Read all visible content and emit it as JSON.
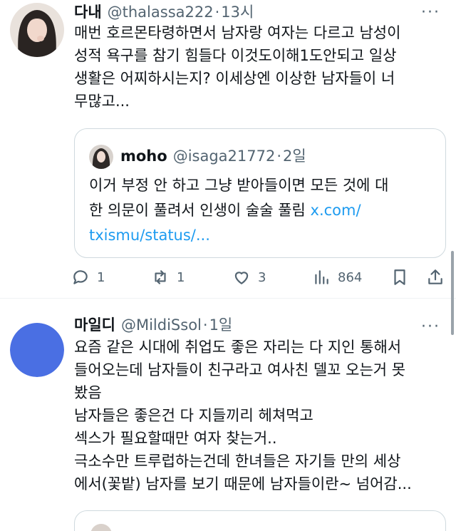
{
  "tweet1": {
    "name": "다내",
    "handle": "@thalassa222",
    "separator": "·",
    "time": "13시",
    "more": "···",
    "lines": [
      "매번 호르몬타령하면서 남자랑 여자는 다르고 남성이",
      "성적 욕구를 참기 힘들다 이것도이해1도안되고 일상",
      "생활은 어찌하시는지? 이세상엔 이상한 남자들이 너",
      "무많고..."
    ],
    "quote": {
      "name": "moho",
      "handle": "@isaga21772",
      "separator": "·",
      "time": "2일",
      "line1": "이거 부정 안 하고 그냥 받아들이면 모든 것에 대",
      "line2_text": "한 의문이 풀려서 인생이 술술 풀림 ",
      "line2_link": "x.com/",
      "line3_link": "txismu/status/..."
    },
    "actions": {
      "reply_count": "1",
      "retweet_count": "1",
      "like_count": "3",
      "view_count": "864"
    }
  },
  "tweet2": {
    "name": "마일디",
    "handle": "@MildiSsol",
    "separator": "·",
    "time": "1일",
    "more": "···",
    "avatar_color": "#4a6fe3",
    "lines": [
      "요즘 같은 시대에 취업도 좋은 자리는 다 지인 통해서",
      "들어오는데 남자들이 친구라고 여사친 델꼬 오는거 못",
      "봤음",
      "남자들은 좋은건 다 지들끼리 헤쳐먹고",
      "섹스가 필요할때만 여자 찾는거..",
      "극소수만 트루럽하는건데 한녀들은 자기들 만의 세상",
      "에서(꽃밭) 남자를 보기 때문에 남자들이란~ 넘어감..."
    ]
  },
  "colors": {
    "secondary_text": "#536471",
    "link": "#1d9bf0",
    "border": "#cfd9de"
  }
}
